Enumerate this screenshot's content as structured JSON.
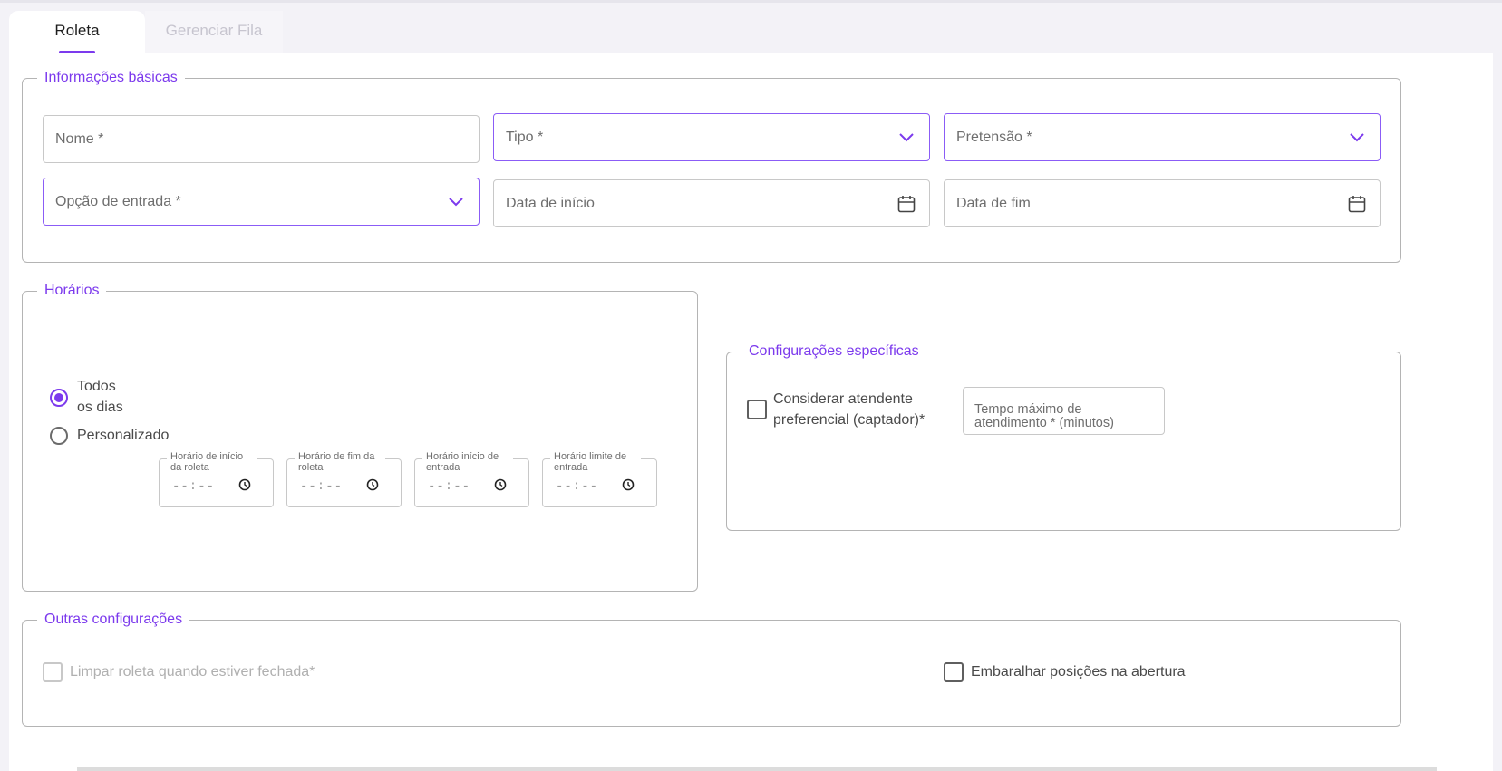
{
  "tabs": {
    "roleta": "Roleta",
    "gerenciar": "Gerenciar Fila"
  },
  "basic": {
    "legend": "Informações básicas",
    "nome": "Nome *",
    "tipo": "Tipo *",
    "pretensao": "Pretensão *",
    "opcao": "Opção de entrada *",
    "data_inicio": "Data de início",
    "data_fim": "Data de fim"
  },
  "horarios": {
    "legend": "Horários",
    "todos_line1": "Todos",
    "todos_line2": "os dias",
    "personalizado": "Personalizado",
    "times": [
      {
        "label": "Horário de início da roleta",
        "value": "--:--"
      },
      {
        "label": "Horário de fim da roleta",
        "value": "--:--"
      },
      {
        "label": "Horário início de entrada",
        "value": "--:--"
      },
      {
        "label": "Horário limite de entrada",
        "value": "--:--"
      }
    ]
  },
  "especificas": {
    "legend": "Configurações específicas",
    "considerar_line1": "Considerar atendente",
    "considerar_line2": "preferencial (captador)*",
    "tempo_line1": "Tempo máximo de",
    "tempo_line2": "atendimento * (minutos)"
  },
  "outras": {
    "legend": "Outras configurações",
    "limpar": "Limpar roleta quando estiver fechada*",
    "embaralhar": "Embaralhar posições na abertura"
  },
  "colors": {
    "accent": "#7c3aed",
    "border": "#b4b4b4"
  }
}
